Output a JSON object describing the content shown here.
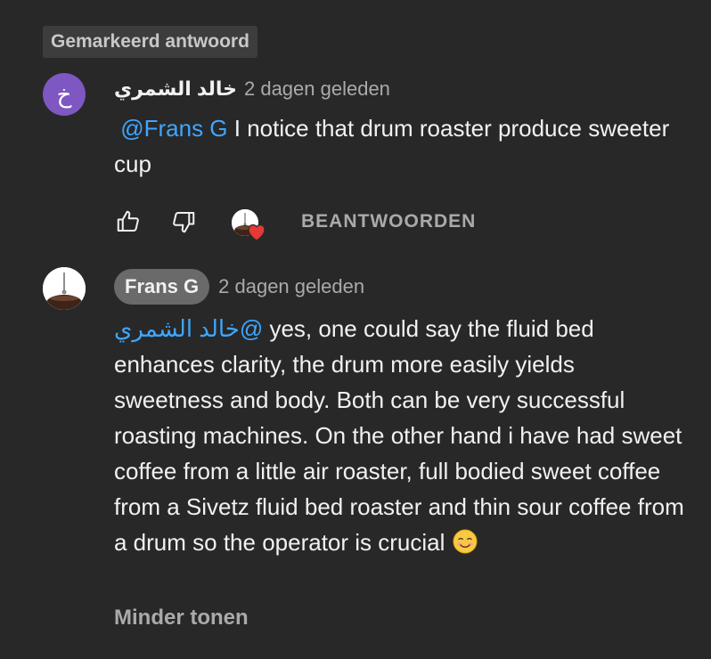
{
  "highlight_badge": "Gemarkeerd antwoord",
  "comments": [
    {
      "avatar_letter": "خ",
      "author": "خالد الشمري",
      "timestamp": "2 dagen geleden",
      "mention": "@Frans G",
      "text": " I notice that drum roaster produce sweeter cup"
    },
    {
      "author": "Frans G",
      "timestamp": "2 dagen geleden",
      "mention": "@خالد الشمري",
      "text": "  yes, one could say the fluid bed enhances clarity, the drum more easily yields sweetness and body.  Both can be very successful roasting machines. On the other hand i have had sweet coffee from a little air roaster, full bodied sweet coffee from a Sivetz fluid bed roaster and thin sour coffee from a drum so the operator is crucial",
      "emoji": "☺️"
    }
  ],
  "actions": {
    "like_icon": "thumbs-up-icon",
    "dislike_icon": "thumbs-down-icon",
    "hearted_icon": "creator-heart-icon",
    "reply_label": "BEANTWOORDEN"
  },
  "show_less_label": "Minder tonen",
  "colors": {
    "background": "#282828",
    "mention": "#3ea6ff",
    "heart": "#e53935",
    "avatar_purple": "#7e57c2"
  }
}
